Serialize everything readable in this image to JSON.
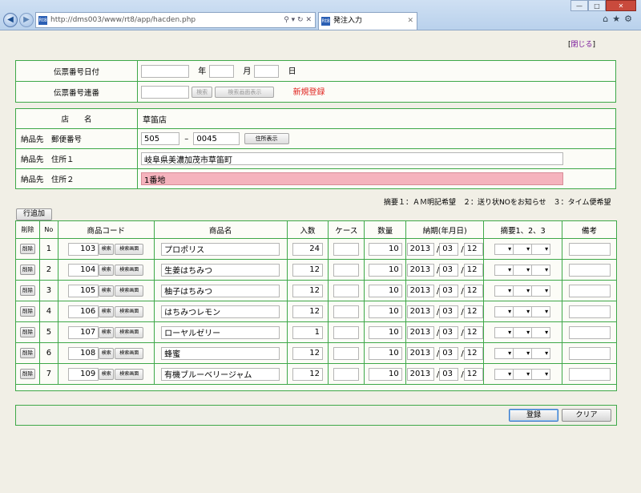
{
  "browser": {
    "url": "http://dms003/www/rt8/app/hacden.php",
    "tab_title": "発注入力",
    "favicon_label": "Rt8"
  },
  "close_link": "閉じる",
  "header": {
    "date_label": "伝票番号日付",
    "year": "年",
    "month": "月",
    "day": "日",
    "serial_label": "伝票番号連番",
    "search_btn": "検索",
    "search_screen_btn": "検索画面表示",
    "status": "新規登録"
  },
  "store": {
    "label": "店　　名",
    "value": "草笛店",
    "zip_label": "納品先　郵便番号",
    "zip1": "505",
    "zip_sep": "–",
    "zip2": "0045",
    "addr_btn": "住所表示",
    "addr1_label": "納品先　住所１",
    "addr1": "岐阜県美濃加茂市草笛町",
    "addr2_label": "納品先　住所２",
    "addr2": "1番地"
  },
  "note": "摘要１：ＡＭ明記希望　２：送り状NOをお知らせ　３：タイム便希望",
  "add_row_btn": "行追加",
  "columns": [
    "削除",
    "No",
    "商品コード",
    "商品名",
    "入数",
    "ケース",
    "数量",
    "納期(年月日)",
    "摘要1、2、3",
    "備考"
  ],
  "row_buttons": {
    "del": "削除",
    "search": "検索",
    "search_screen": "検索画面"
  },
  "rows": [
    {
      "no": "1",
      "code": "103",
      "name": "プロポリス",
      "iri": "24",
      "case": "",
      "qty": "10",
      "year": "2013",
      "month": "03",
      "day": "12"
    },
    {
      "no": "2",
      "code": "104",
      "name": "生姜はちみつ",
      "iri": "12",
      "case": "",
      "qty": "10",
      "year": "2013",
      "month": "03",
      "day": "12"
    },
    {
      "no": "3",
      "code": "105",
      "name": "柚子はちみつ",
      "iri": "12",
      "case": "",
      "qty": "10",
      "year": "2013",
      "month": "03",
      "day": "12"
    },
    {
      "no": "4",
      "code": "106",
      "name": "はちみつレモン",
      "iri": "12",
      "case": "",
      "qty": "10",
      "year": "2013",
      "month": "03",
      "day": "12"
    },
    {
      "no": "5",
      "code": "107",
      "name": "ローヤルゼリー",
      "iri": "1",
      "case": "",
      "qty": "10",
      "year": "2013",
      "month": "03",
      "day": "12"
    },
    {
      "no": "6",
      "code": "108",
      "name": "蜂蜜",
      "iri": "12",
      "case": "",
      "qty": "10",
      "year": "2013",
      "month": "03",
      "day": "12"
    },
    {
      "no": "7",
      "code": "109",
      "name": "有機ブルーベリージャム",
      "iri": "12",
      "case": "",
      "qty": "10",
      "year": "2013",
      "month": "03",
      "day": "12"
    }
  ],
  "date_sep": "/",
  "footer": {
    "register": "登録",
    "clear": "クリア"
  },
  "colors": {
    "border": "#3ea848",
    "status": "#e0201c",
    "addr2_bg": "#f5b3bd"
  }
}
